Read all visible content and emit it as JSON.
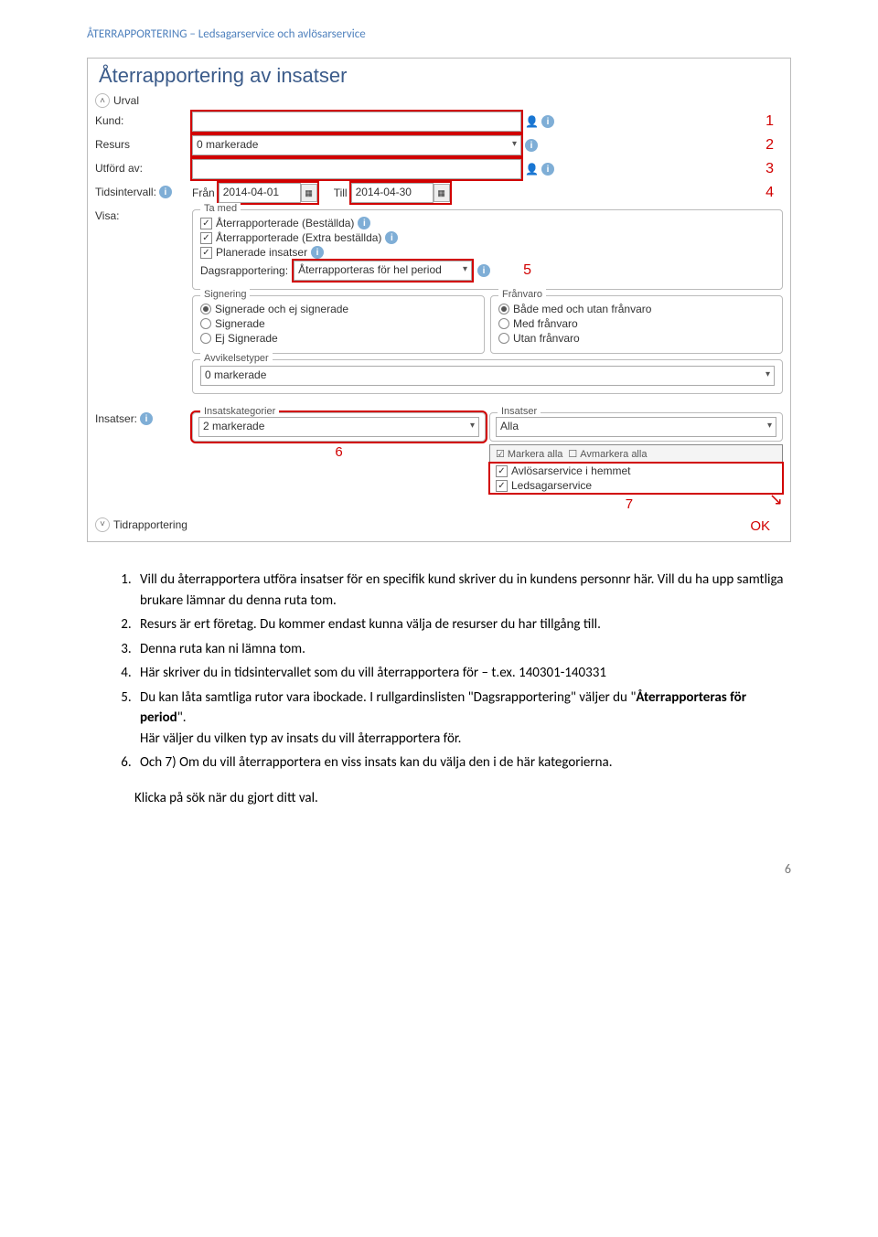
{
  "header": "ÅTERRAPPORTERING – Ledsagarservice och avlösarservice",
  "app": {
    "title": "Återrapportering av insatser",
    "urval_heading": "Urval",
    "labels": {
      "kund": "Kund:",
      "resurs": "Resurs",
      "utford": "Utförd av:",
      "tidsintervall": "Tidsintervall:",
      "fran": "Från",
      "till": "Till",
      "visa": "Visa:",
      "insatser": "Insatser:",
      "tidrapportering": "Tidrapportering"
    },
    "resurs_value": "0 markerade",
    "fran_value": "2014-04-01",
    "till_value": "2014-04-30",
    "callouts": {
      "c1": "1",
      "c2": "2",
      "c3": "3",
      "c4": "4",
      "c5": "5",
      "c6": "6",
      "c7": "7",
      "ok": "OK"
    },
    "ta_med": {
      "legend": "Ta med",
      "opt1": "Återrapporterade (Beställda)",
      "opt2": "Återrapporterade (Extra beställda)",
      "opt3": "Planerade insatser",
      "dags_label": "Dagsrapportering:",
      "dags_value": "Återrapporteras för hel period"
    },
    "signering": {
      "legend": "Signering",
      "r1": "Signerade och ej signerade",
      "r2": "Signerade",
      "r3": "Ej Signerade"
    },
    "franvaro": {
      "legend": "Frånvaro",
      "r1": "Både med och utan frånvaro",
      "r2": "Med frånvaro",
      "r3": "Utan frånvaro"
    },
    "avvikelse": {
      "legend": "Avvikelsetyper",
      "value": "0 markerade"
    },
    "insats": {
      "kat_legend": "Insatskategorier",
      "kat_value": "2 markerade",
      "ins_legend": "Insatser",
      "ins_value": "Alla",
      "markera": "Markera alla",
      "avmarkera": "Avmarkera alla",
      "item1": "Avlösarservice i hemmet",
      "item2": "Ledsagarservice"
    }
  },
  "instructions": {
    "i1a": "Vill du återrapportera utföra insatser för en specifik kund skriver du in kundens personnr här. Vill du ha upp samtliga brukare lämnar du denna ruta tom.",
    "i2": "Resurs är ert företag. Du kommer endast kunna välja de resurser du har tillgång till.",
    "i3": "Denna ruta kan ni lämna tom.",
    "i4": "Här skriver du in tidsintervallet som du vill återrapportera för – t.ex. 140301-140331",
    "i5a": "Du kan låta samtliga rutor vara ibockade. I rullgardinslisten \"Dagsrapportering\" väljer du \"",
    "i5b": "Återrapporteras för period",
    "i5c": "\".",
    "i5d": "Här väljer du vilken typ av insats du vill återrapportera för.",
    "i6": "Och 7) Om du vill återrapportera en viss insats kan du välja den i de här kategorierna.",
    "closing": "Klicka på sök när du gjort ditt val."
  },
  "page_number": "6"
}
